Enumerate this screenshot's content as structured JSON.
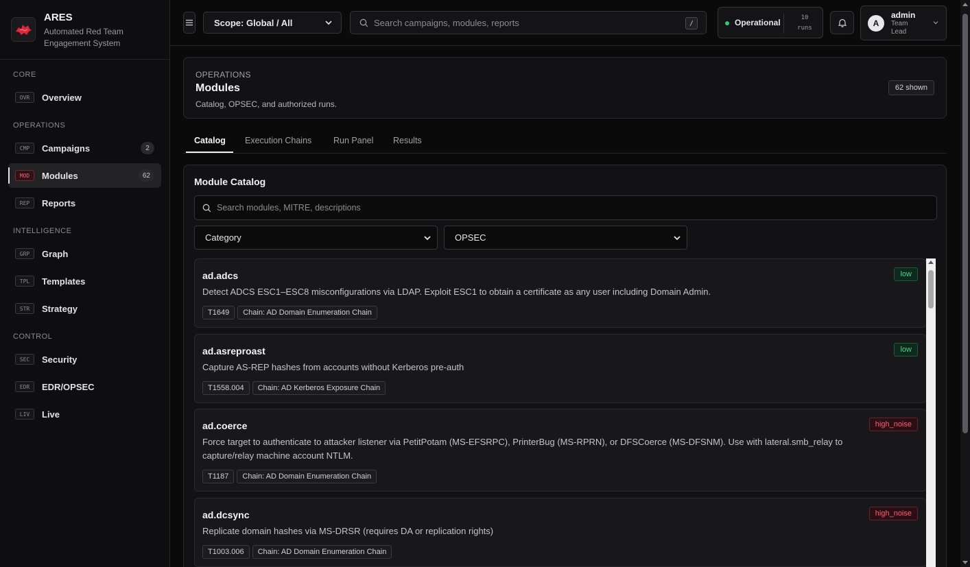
{
  "app": {
    "name": "ARES",
    "subtitle": "Automated Red Team Engagement System"
  },
  "sidebar": {
    "sections": [
      {
        "label": "CORE"
      },
      {
        "label": "OPERATIONS"
      },
      {
        "label": "INTELLIGENCE"
      },
      {
        "label": "CONTROL"
      }
    ],
    "items": [
      {
        "code": "OVR",
        "label": "Overview"
      },
      {
        "code": "CMP",
        "label": "Campaigns",
        "count": "2"
      },
      {
        "code": "MOD",
        "label": "Modules",
        "count": "62",
        "active": true
      },
      {
        "code": "REP",
        "label": "Reports"
      },
      {
        "code": "GRP",
        "label": "Graph"
      },
      {
        "code": "TPL",
        "label": "Templates"
      },
      {
        "code": "STR",
        "label": "Strategy"
      },
      {
        "code": "SEC",
        "label": "Security"
      },
      {
        "code": "EDR",
        "label": "EDR/OPSEC"
      },
      {
        "code": "LIV",
        "label": "Live"
      }
    ]
  },
  "topbar": {
    "scope": "Scope: Global / All",
    "search_placeholder": "Search campaigns, modules, reports",
    "search_kbd": "/",
    "status": "Operational",
    "runs_count": "10",
    "runs_label": "runs",
    "user": {
      "initial": "A",
      "name": "admin",
      "role": "Team Lead"
    }
  },
  "page": {
    "kicker": "OPERATIONS",
    "title": "Modules",
    "description": "Catalog, OPSEC, and authorized runs.",
    "shown": "62 shown"
  },
  "tabs": [
    "Catalog",
    "Execution Chains",
    "Run Panel",
    "Results"
  ],
  "catalog": {
    "title": "Module Catalog",
    "search_placeholder": "Search modules, MITRE, descriptions",
    "category_select": "Category",
    "opsec_select": "OPSEC",
    "modules": [
      {
        "name": "ad.adcs",
        "description": "Detect ADCS ESC1–ESC8 misconfigurations via LDAP. Exploit ESC1 to obtain a certificate as any user including Domain Admin.",
        "mitre": "T1649",
        "chain": "Chain: AD Domain Enumeration Chain",
        "opsec": "low"
      },
      {
        "name": "ad.asreproast",
        "description": "Capture AS-REP hashes from accounts without Kerberos pre-auth",
        "mitre": "T1558.004",
        "chain": "Chain: AD Kerberos Exposure Chain",
        "opsec": "low"
      },
      {
        "name": "ad.coerce",
        "description": "Force target to authenticate to attacker listener via PetitPotam (MS-EFSRPC), PrinterBug (MS-RPRN), or DFSCoerce (MS-DFSNM). Use with lateral.smb_relay to capture/relay machine account NTLM.",
        "mitre": "T1187",
        "chain": "Chain: AD Domain Enumeration Chain",
        "opsec": "high_noise"
      },
      {
        "name": "ad.dcsync",
        "description": "Replicate domain hashes via MS-DRSR (requires DA or replication rights)",
        "mitre": "T1003.006",
        "chain": "Chain: AD Domain Enumeration Chain",
        "opsec": "high_noise"
      }
    ]
  },
  "colors": {
    "accent_red": "#ff5a6a",
    "status_green": "#2ecc71",
    "opsec_low": "#45d68a",
    "opsec_high": "#ff5d74"
  }
}
